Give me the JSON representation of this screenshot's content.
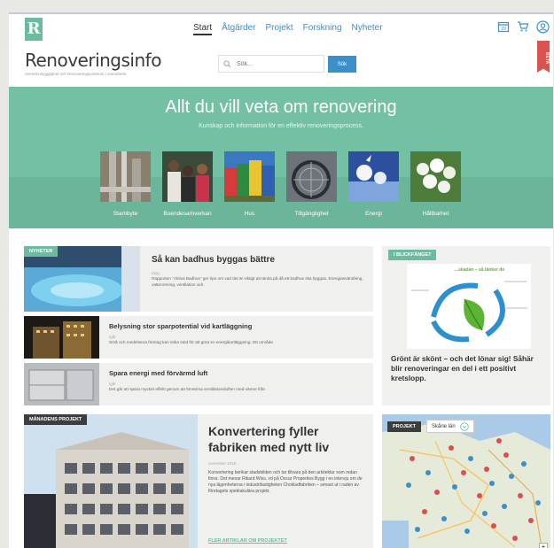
{
  "logo": {
    "letter": "R"
  },
  "nav": {
    "items": [
      "Start",
      "Åtgärder",
      "Projekt",
      "Forskning",
      "Nyheter"
    ]
  },
  "brand": {
    "title": "Renoveringsinfo",
    "subtitle": "Svenskt Byggtjänst och Renoveringscentrum i samarbete"
  },
  "search": {
    "placeholder": "Sök...",
    "button": "Sök"
  },
  "beta": "BETA",
  "hero": {
    "title": "Allt du vill veta om renovering",
    "subtitle": "Kunskap och information för en effektiv renoveringsprocess."
  },
  "categories": [
    "Stambyte",
    "Boendesamverkan",
    "Hus",
    "Tillgänglighet",
    "Energi",
    "Hållbarhet"
  ],
  "news": {
    "tag": "NYHETER",
    "items": [
      {
        "title": "Så kan badhus byggas bättre",
        "meta": "Idag",
        "text": "Rapporten \"Aktiva Badhus\" ger tips om vad det är viktigt att tänka på då ett badhus ska byggas. Energianvändning, vattenrening, ventilation och"
      },
      {
        "title": "Belysning stor sparpotential vid kartläggning",
        "meta": "Igår",
        "text": "Små och medelstora företag kan söka stöd för att göra en energikartläggning. Ett område"
      },
      {
        "title": "Spara energi med förvärmd luft",
        "meta": "Igår",
        "text": "Det går att spara mycket effekt genom att förvärma ventilationsluften med värme från"
      }
    ]
  },
  "glance": {
    "tag": "I BLICKFÅNGET",
    "image_heading": "...skadan – så tänker de",
    "text": "Grönt är skönt – och det lönar sig! Såhär blir renoveringar en del i ett positivt kretslopp."
  },
  "project_month": {
    "tag": "MÅNADENS PROJEKT",
    "title": "Konvertering fyller fabriken med nytt liv",
    "date": "november 2015",
    "text": "Konvertering berikar stadsbilden och tar tillvara på den arkitektur som redan finns. Det menar Rikard Wiss, vd på Oscar Properties Bygg i en intervju om de nya lägenheterna i industrifastigheten Chokladfabriken – senast ut i raden av företagets spektakulära projekt.",
    "link": "FLER ARTIKLAR OM PROJEKTET"
  },
  "map": {
    "tag": "PROJEKT",
    "region": "Skåne län",
    "zoom": "+"
  },
  "colors": {
    "accent_green": "#74c0a4",
    "link_blue": "#3d8fc9",
    "beta_red": "#d9534f"
  }
}
